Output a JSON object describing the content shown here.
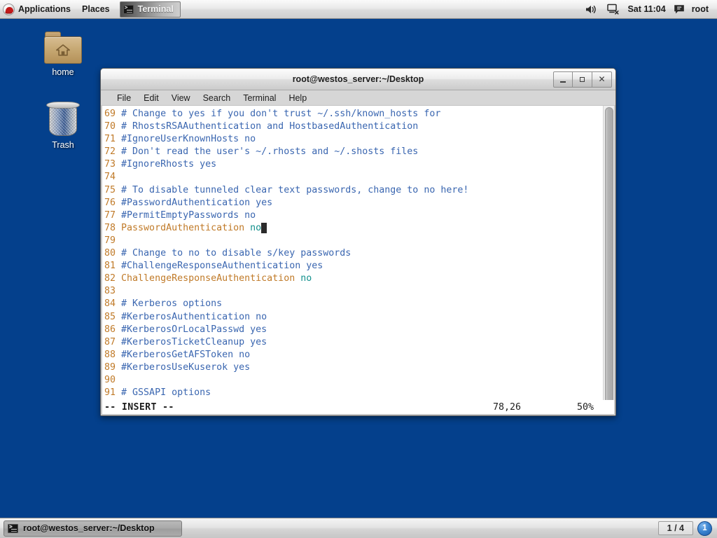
{
  "top_panel": {
    "applications_label": "Applications",
    "places_label": "Places",
    "tasklist_label": "Terminal",
    "clock": "Sat 11:04",
    "user": "root",
    "icons": {
      "menu": "redhat-logo-icon",
      "task": "terminal-icon",
      "volume": "volume-icon",
      "network": "network-disconnected-icon",
      "message": "message-icon"
    }
  },
  "desktop": {
    "icons": [
      {
        "label": "home",
        "icon": "home-folder-icon"
      },
      {
        "label": "Trash",
        "icon": "trash-can-icon"
      }
    ],
    "background_color": "#04408c"
  },
  "terminal_window": {
    "title": "root@westos_server:~/Desktop",
    "window_buttons": {
      "minimize": "_",
      "maximize": "□",
      "close": "✕"
    },
    "menu": [
      "File",
      "Edit",
      "View",
      "Search",
      "Terminal",
      "Help"
    ],
    "lines": [
      {
        "num": "69",
        "segments": [
          {
            "text": "# Change to yes if you don't trust ~/.ssh/known_hosts for",
            "cls": "cmt"
          }
        ]
      },
      {
        "num": "70",
        "segments": [
          {
            "text": "# RhostsRSAAuthentication and HostbasedAuthentication",
            "cls": "cmt"
          }
        ]
      },
      {
        "num": "71",
        "segments": [
          {
            "text": "#IgnoreUserKnownHosts no",
            "cls": "cmt"
          }
        ]
      },
      {
        "num": "72",
        "segments": [
          {
            "text": "# Don't read the user's ~/.rhosts and ~/.shosts files",
            "cls": "cmt"
          }
        ]
      },
      {
        "num": "73",
        "segments": [
          {
            "text": "#IgnoreRhosts yes",
            "cls": "cmt"
          }
        ]
      },
      {
        "num": "74",
        "segments": []
      },
      {
        "num": "75",
        "segments": [
          {
            "text": "# To disable tunneled clear text passwords, change to no here!",
            "cls": "cmt"
          }
        ]
      },
      {
        "num": "76",
        "segments": [
          {
            "text": "#PasswordAuthentication yes",
            "cls": "cmt"
          }
        ]
      },
      {
        "num": "77",
        "segments": [
          {
            "text": "#PermitEmptyPasswords no",
            "cls": "cmt"
          }
        ]
      },
      {
        "num": "78",
        "segments": [
          {
            "text": "PasswordAuthentication ",
            "cls": "kw"
          },
          {
            "text": "no",
            "cls": "val"
          },
          {
            "text": " ",
            "cls": "cursor"
          }
        ]
      },
      {
        "num": "79",
        "segments": []
      },
      {
        "num": "80",
        "segments": [
          {
            "text": "# Change to no to disable s/key passwords",
            "cls": "cmt"
          }
        ]
      },
      {
        "num": "81",
        "segments": [
          {
            "text": "#ChallengeResponseAuthentication yes",
            "cls": "cmt"
          }
        ]
      },
      {
        "num": "82",
        "segments": [
          {
            "text": "ChallengeResponseAuthentication ",
            "cls": "kw"
          },
          {
            "text": "no",
            "cls": "val"
          }
        ]
      },
      {
        "num": "83",
        "segments": []
      },
      {
        "num": "84",
        "segments": [
          {
            "text": "# Kerberos options",
            "cls": "cmt"
          }
        ]
      },
      {
        "num": "85",
        "segments": [
          {
            "text": "#KerberosAuthentication no",
            "cls": "cmt"
          }
        ]
      },
      {
        "num": "86",
        "segments": [
          {
            "text": "#KerberosOrLocalPasswd yes",
            "cls": "cmt"
          }
        ]
      },
      {
        "num": "87",
        "segments": [
          {
            "text": "#KerberosTicketCleanup yes",
            "cls": "cmt"
          }
        ]
      },
      {
        "num": "88",
        "segments": [
          {
            "text": "#KerberosGetAFSToken no",
            "cls": "cmt"
          }
        ]
      },
      {
        "num": "89",
        "segments": [
          {
            "text": "#KerberosUseKuserok yes",
            "cls": "cmt"
          }
        ]
      },
      {
        "num": "90",
        "segments": []
      },
      {
        "num": "91",
        "segments": [
          {
            "text": "# GSSAPI options",
            "cls": "cmt"
          }
        ]
      }
    ],
    "status": {
      "mode": "-- INSERT --",
      "position": "78,26",
      "percent": "50%"
    },
    "colors": {
      "line_number": "#c07a28",
      "comment": "#3a66b0",
      "keyword": "#c07a28",
      "value": "#13918d",
      "background": "#ffffff"
    }
  },
  "bottom_panel": {
    "window_button_label": "root@westos_server:~/Desktop",
    "window_button_icon": "terminal-icon",
    "workspace": "1 / 4",
    "notification_count": "1"
  }
}
